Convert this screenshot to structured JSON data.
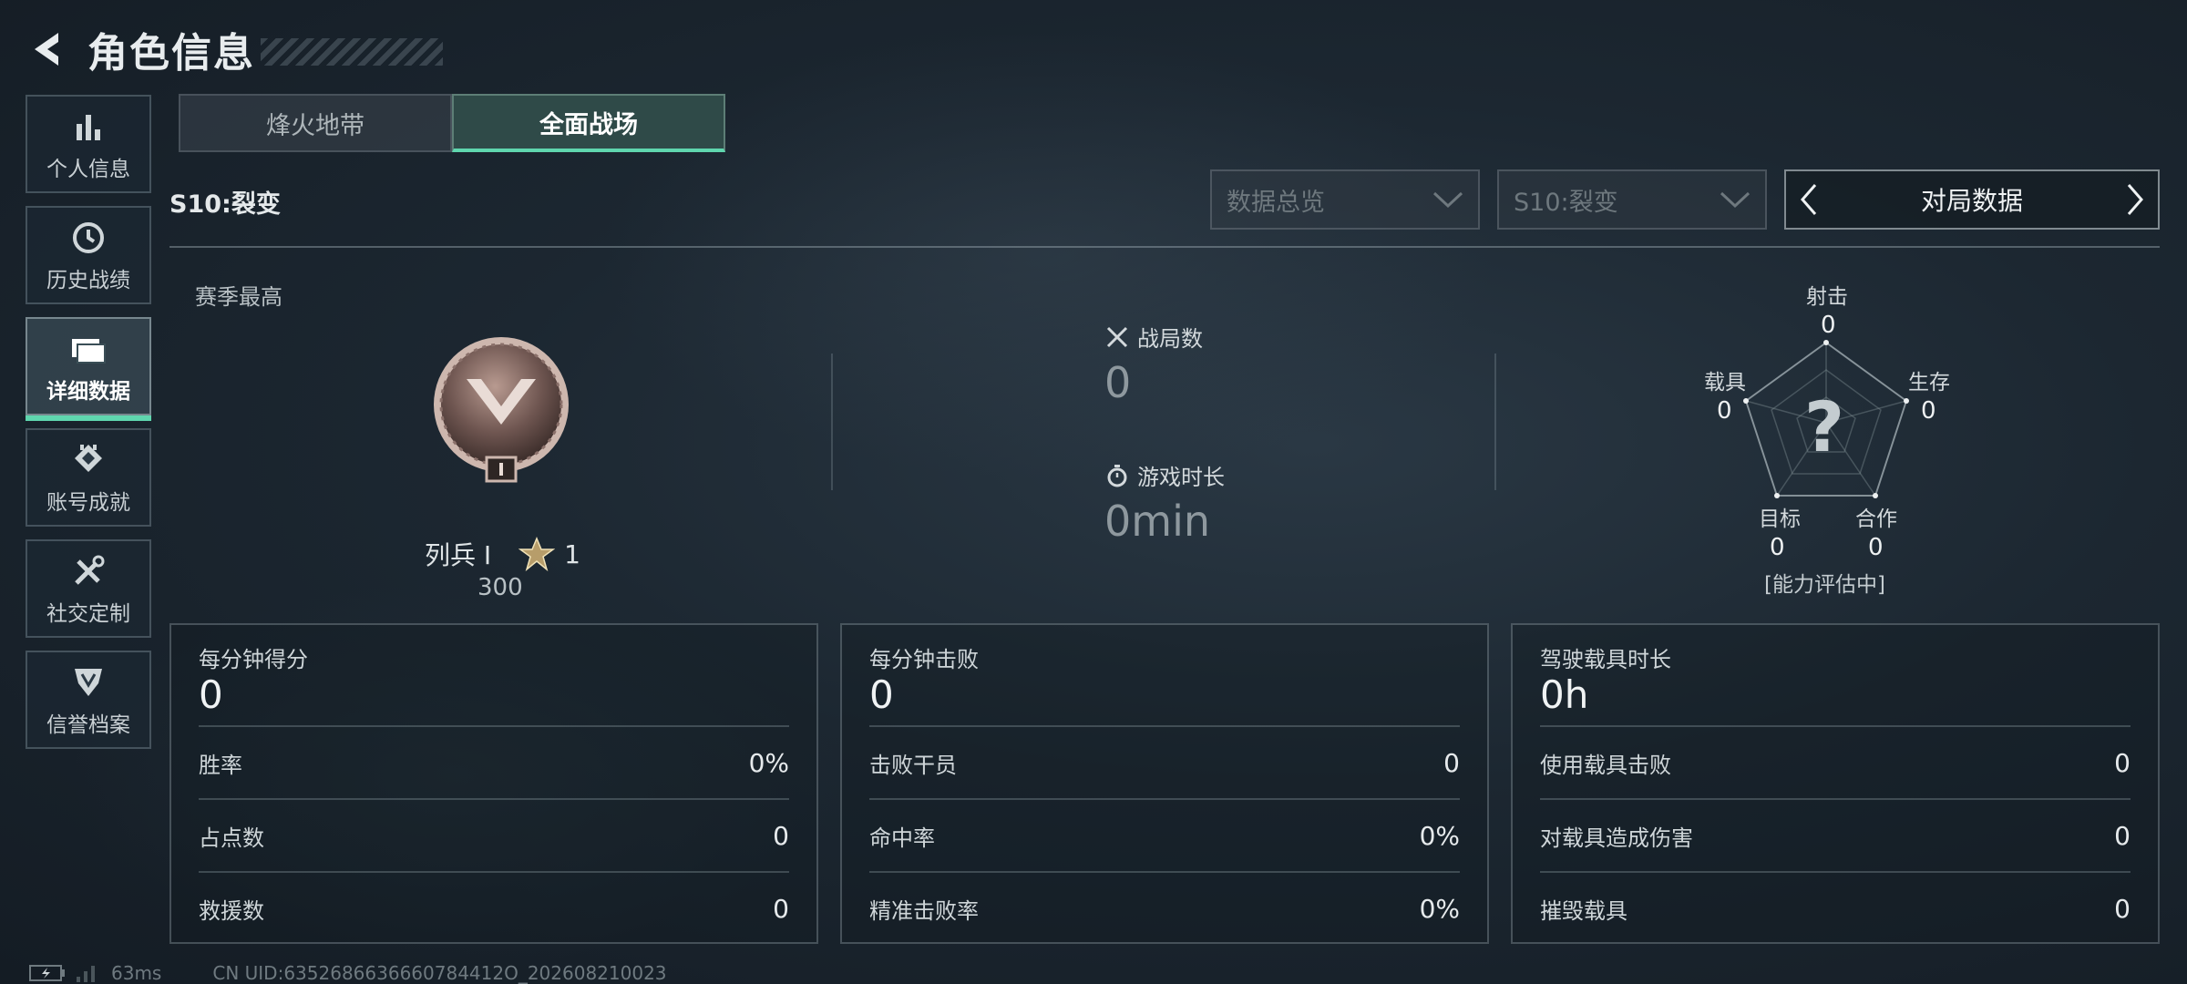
{
  "header": {
    "title": "角色信息"
  },
  "sidebar": {
    "items": [
      {
        "label": "个人信息",
        "icon": "bar-chart-icon"
      },
      {
        "label": "历史战绩",
        "icon": "history-icon"
      },
      {
        "label": "详细数据",
        "icon": "folder-icon",
        "active": true
      },
      {
        "label": "账号成就",
        "icon": "achievement-icon"
      },
      {
        "label": "社交定制",
        "icon": "tools-icon"
      },
      {
        "label": "信誉档案",
        "icon": "shield-icon"
      }
    ]
  },
  "tabs": [
    {
      "label": "烽火地带",
      "active": false
    },
    {
      "label": "全面战场",
      "active": true
    }
  ],
  "season": {
    "label": "S10:裂变"
  },
  "filters": {
    "data_type": "数据总览",
    "season": "S10:裂变",
    "match_data": "对局数据"
  },
  "overview": {
    "season_best_label": "赛季最高",
    "rank_name": "列兵 Ⅰ",
    "stars": "1",
    "rank_points": "300",
    "matches_label": "战局数",
    "matches_value": "0",
    "playtime_label": "游戏时长",
    "playtime_value": "0min"
  },
  "radar": {
    "center": "?",
    "status": "[能力评估中]",
    "axes": [
      {
        "label": "射击",
        "value": "0"
      },
      {
        "label": "生存",
        "value": "0"
      },
      {
        "label": "合作",
        "value": "0"
      },
      {
        "label": "目标",
        "value": "0"
      },
      {
        "label": "载具",
        "value": "0"
      }
    ]
  },
  "cards": [
    {
      "title": "每分钟得分",
      "value": "0",
      "rows": [
        {
          "label": "胜率",
          "value": "0%"
        },
        {
          "label": "占点数",
          "value": "0"
        },
        {
          "label": "救援数",
          "value": "0"
        }
      ]
    },
    {
      "title": "每分钟击败",
      "value": "0",
      "rows": [
        {
          "label": "击败干员",
          "value": "0"
        },
        {
          "label": "命中率",
          "value": "0%"
        },
        {
          "label": "精准击败率",
          "value": "0%"
        }
      ]
    },
    {
      "title": "驾驶载具时长",
      "value": "0h",
      "rows": [
        {
          "label": "使用载具击败",
          "value": "0"
        },
        {
          "label": "对载具造成伤害",
          "value": "0"
        },
        {
          "label": "摧毁载具",
          "value": "0"
        }
      ]
    }
  ],
  "footer": {
    "ping": "63ms",
    "uid": "CN UID:6352686636660784412O_202608210023"
  },
  "colors": {
    "accent": "#5fd6ae",
    "background": "#1c2731"
  }
}
